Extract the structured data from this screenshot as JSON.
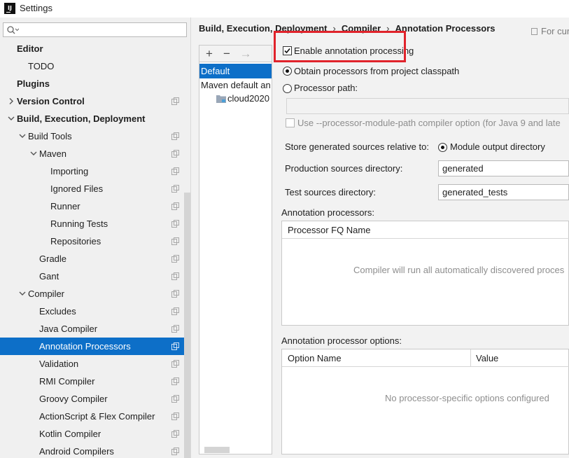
{
  "window": {
    "title": "Settings",
    "app_icon": "intellij-icon"
  },
  "search": {
    "placeholder": ""
  },
  "tree": [
    {
      "label": "Editor",
      "bold": true,
      "indent": 0,
      "arrow": "none",
      "copy": false
    },
    {
      "label": "TODO",
      "bold": false,
      "indent": 1,
      "arrow": "none",
      "copy": false
    },
    {
      "label": "Plugins",
      "bold": true,
      "indent": 0,
      "arrow": "none",
      "copy": false
    },
    {
      "label": "Version Control",
      "bold": true,
      "indent": 0,
      "arrow": "right",
      "copy": true
    },
    {
      "label": "Build, Execution, Deployment",
      "bold": true,
      "indent": 0,
      "arrow": "down",
      "copy": false
    },
    {
      "label": "Build Tools",
      "bold": false,
      "indent": 1,
      "arrow": "down",
      "copy": true
    },
    {
      "label": "Maven",
      "bold": false,
      "indent": 2,
      "arrow": "down",
      "copy": true
    },
    {
      "label": "Importing",
      "bold": false,
      "indent": 3,
      "arrow": "none",
      "copy": true
    },
    {
      "label": "Ignored Files",
      "bold": false,
      "indent": 3,
      "arrow": "none",
      "copy": true
    },
    {
      "label": "Runner",
      "bold": false,
      "indent": 3,
      "arrow": "none",
      "copy": true
    },
    {
      "label": "Running Tests",
      "bold": false,
      "indent": 3,
      "arrow": "none",
      "copy": true
    },
    {
      "label": "Repositories",
      "bold": false,
      "indent": 3,
      "arrow": "none",
      "copy": true
    },
    {
      "label": "Gradle",
      "bold": false,
      "indent": 2,
      "arrow": "none",
      "copy": true
    },
    {
      "label": "Gant",
      "bold": false,
      "indent": 2,
      "arrow": "none",
      "copy": true
    },
    {
      "label": "Compiler",
      "bold": false,
      "indent": 1,
      "arrow": "down",
      "copy": true
    },
    {
      "label": "Excludes",
      "bold": false,
      "indent": 2,
      "arrow": "none",
      "copy": true
    },
    {
      "label": "Java Compiler",
      "bold": false,
      "indent": 2,
      "arrow": "none",
      "copy": true
    },
    {
      "label": "Annotation Processors",
      "bold": false,
      "indent": 2,
      "arrow": "none",
      "copy": true,
      "selected": true
    },
    {
      "label": "Validation",
      "bold": false,
      "indent": 2,
      "arrow": "none",
      "copy": true
    },
    {
      "label": "RMI Compiler",
      "bold": false,
      "indent": 2,
      "arrow": "none",
      "copy": true
    },
    {
      "label": "Groovy Compiler",
      "bold": false,
      "indent": 2,
      "arrow": "none",
      "copy": true
    },
    {
      "label": "ActionScript & Flex Compiler",
      "bold": false,
      "indent": 2,
      "arrow": "none",
      "copy": true
    },
    {
      "label": "Kotlin Compiler",
      "bold": false,
      "indent": 2,
      "arrow": "none",
      "copy": true
    },
    {
      "label": "Android Compilers",
      "bold": false,
      "indent": 2,
      "arrow": "none",
      "copy": true
    }
  ],
  "breadcrumb": [
    "Build, Execution, Deployment",
    "Compiler",
    "Annotation Processors"
  ],
  "for_current": "For cur",
  "profiles": {
    "toolbar": {
      "add": "+",
      "remove": "−",
      "move": "→"
    },
    "items": [
      "Default",
      "Maven default an",
      "cloud2020"
    ],
    "selected_index": 0
  },
  "options": {
    "enable_processing": {
      "label": "Enable annotation processing",
      "checked": true
    },
    "obtain_from_classpath": {
      "label": "Obtain processors from project classpath",
      "selected": true
    },
    "processor_path": {
      "label": "Processor path:",
      "selected": false,
      "value": ""
    },
    "module_path_option": {
      "label": "Use --processor-module-path compiler option (for Java 9 and late",
      "checked": false,
      "disabled": true
    },
    "store_generated": {
      "label": "Store generated sources relative to:",
      "choice": "Module output directory",
      "selected": true
    },
    "production_dir": {
      "label": "Production sources directory:",
      "value": "generated"
    },
    "test_dir": {
      "label": "Test sources directory:",
      "value": "generated_tests"
    }
  },
  "processors_table": {
    "title": "Annotation processors:",
    "column": "Processor FQ Name",
    "empty_text": "Compiler will run all automatically discovered proces"
  },
  "options_table": {
    "title": "Annotation processor options:",
    "columns": [
      "Option Name",
      "Value"
    ],
    "empty_text": "No processor-specific options configured"
  },
  "colors": {
    "selection": "#0d6fc8",
    "highlight": "#e0232b",
    "panel": "#f2f2f2"
  }
}
